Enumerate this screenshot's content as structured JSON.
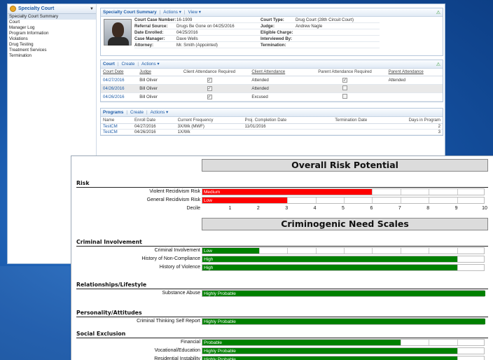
{
  "sidebar": {
    "title": "Specialty Court",
    "items": [
      {
        "label": "Specialty Court Summary"
      },
      {
        "label": "Court"
      },
      {
        "label": "Manager Log"
      },
      {
        "label": "Program Information"
      },
      {
        "label": "Violations"
      },
      {
        "label": "Drug Testing"
      },
      {
        "label": "Treatment Services"
      },
      {
        "label": "Termination"
      }
    ]
  },
  "summary": {
    "title": "Specialty Court Summary",
    "actions": "Actions",
    "view": "View",
    "fields": [
      {
        "k": "Court Case Number:",
        "v": "16-1909",
        "k2": "Court Type:",
        "v2": "Drug Court (28th Circuit Court)"
      },
      {
        "k": "Referral Source:",
        "v": "Drugs Be Gone on 04/25/2016",
        "k2": "Judge:",
        "v2": "Andrew Nagle"
      },
      {
        "k": "Date Enrolled:",
        "v": "04/25/2016",
        "k2": "Eligible Charge:",
        "v2": ""
      },
      {
        "k": "Case Manager:",
        "v": "Dave Wells",
        "k2": "Interviewed By:",
        "v2": ""
      },
      {
        "k": "Attorney:",
        "v": "Mr. Smith (Appointed)",
        "k2": "Termination:",
        "v2": ""
      }
    ]
  },
  "court": {
    "title": "Court",
    "create": "Create",
    "actions": "Actions",
    "headers": [
      "Court Date",
      "Judge",
      "Client Attendance Required",
      "Client Attendance",
      "Parent Attendance Required",
      "Parent Attendance"
    ],
    "rows": [
      {
        "date": "04/27/2016",
        "judge": "Bill Oliver",
        "req": true,
        "att": "Attended",
        "preq": true,
        "patt": "Attended"
      },
      {
        "date": "04/26/2016",
        "judge": "Bill Oliver",
        "req": true,
        "att": "Attended",
        "preq": false,
        "patt": ""
      },
      {
        "date": "04/26/2016",
        "judge": "Bill Oliver",
        "req": true,
        "att": "Excused",
        "preq": false,
        "patt": ""
      }
    ]
  },
  "programs": {
    "title": "Programs",
    "create": "Create",
    "actions": "Actions",
    "headers": [
      "Name",
      "Enroll Date",
      "Current Frequency",
      "Proj. Completion Date",
      "Termination Date",
      "Days in Program"
    ],
    "rows": [
      {
        "name": "TestCM",
        "enroll": "04/27/2016",
        "freq": "3X/Wk (MWF)",
        "proj": "11/01/2016",
        "term": "",
        "days": "2"
      },
      {
        "name": "TestCM",
        "enroll": "04/26/2016",
        "freq": "1X/Wk",
        "proj": "",
        "term": "",
        "days": "3"
      }
    ]
  },
  "report": {
    "title_overall": "Overall Risk Potential",
    "title_needs": "Criminogenic Need Scales",
    "decile_label": "Decile",
    "ticks": [
      "1",
      "2",
      "3",
      "4",
      "5",
      "6",
      "7",
      "8",
      "9",
      "10"
    ],
    "colors": {
      "red": "#ff0000",
      "green": "#008000"
    },
    "sections": [
      {
        "title": "Risk",
        "scales": [
          {
            "label": "Violent Recidivism Risk",
            "level": "Medium",
            "decile": 6,
            "color": "red"
          },
          {
            "label": "General Recidivism Risk",
            "level": "Low",
            "decile": 3,
            "color": "red"
          }
        ]
      },
      {
        "title": "Criminal Involvement",
        "scales": [
          {
            "label": "Criminal Involvement",
            "level": "Low",
            "decile": 2,
            "color": "green"
          },
          {
            "label": "History of Non-Compliance",
            "level": "High",
            "decile": 9,
            "color": "green"
          },
          {
            "label": "History of Violence",
            "level": "High",
            "decile": 9,
            "color": "green"
          }
        ]
      },
      {
        "title": "Relationships/Lifestyle",
        "scales": [
          {
            "label": "Substance Abuse",
            "level": "Highly Probable",
            "decile": 10,
            "color": "green"
          }
        ]
      },
      {
        "title": "Personality/Attitudes",
        "scales": [
          {
            "label": "Criminal Thinking Self Report",
            "level": "Highly Probable",
            "decile": 10,
            "color": "green"
          }
        ]
      },
      {
        "title": "Social Exclusion",
        "scales": [
          {
            "label": "Financial",
            "level": "Probable",
            "decile": 7,
            "color": "green"
          },
          {
            "label": "Vocational/Education",
            "level": "Highly Probable",
            "decile": 9,
            "color": "green"
          },
          {
            "label": "Residential Instability",
            "level": "Highly Probable",
            "decile": 9,
            "color": "green"
          }
        ]
      }
    ]
  }
}
